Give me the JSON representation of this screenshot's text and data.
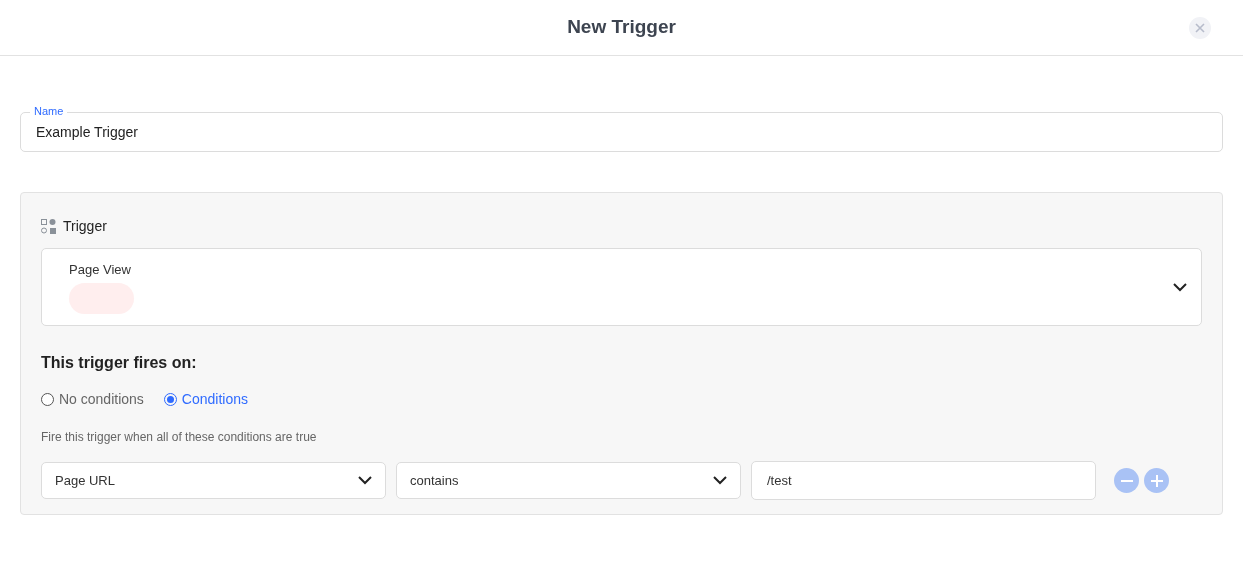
{
  "dialog": {
    "title": "New Trigger"
  },
  "name_field": {
    "label": "Name",
    "value": "Example Trigger"
  },
  "trigger": {
    "heading": "Trigger",
    "type": "Page View"
  },
  "fires_on": {
    "heading": "This trigger fires on:",
    "options": [
      {
        "label": "No conditions",
        "selected": false
      },
      {
        "label": "Conditions",
        "selected": true
      }
    ],
    "hint": "Fire this trigger when all of these conditions are true",
    "conditions": [
      {
        "variable": "Page URL",
        "operator": "contains",
        "value": "/test"
      }
    ]
  }
}
